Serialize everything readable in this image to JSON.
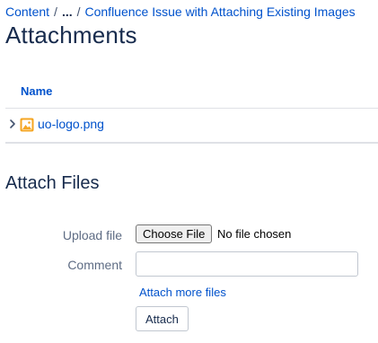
{
  "breadcrumb": {
    "root": "Content",
    "separator": "/",
    "ellipsis": "...",
    "current": "Confluence Issue with Attaching Existing Images"
  },
  "page_title": "Attachments",
  "table": {
    "columns": [
      "Name"
    ],
    "rows": [
      {
        "name": "uo-logo.png",
        "icon": "image-file-icon"
      }
    ]
  },
  "attach_section": {
    "title": "Attach Files",
    "upload_label": "Upload file",
    "choose_file_label": "Choose File",
    "file_status": "No file chosen",
    "comment_label": "Comment",
    "comment_value": "",
    "attach_more_label": "Attach more files",
    "attach_button_label": "Attach"
  },
  "colors": {
    "link": "#0052cc",
    "text": "#172b4d",
    "muted": "#5e6c84",
    "border": "#dfe1e6",
    "file_icon": "#f5a623"
  }
}
